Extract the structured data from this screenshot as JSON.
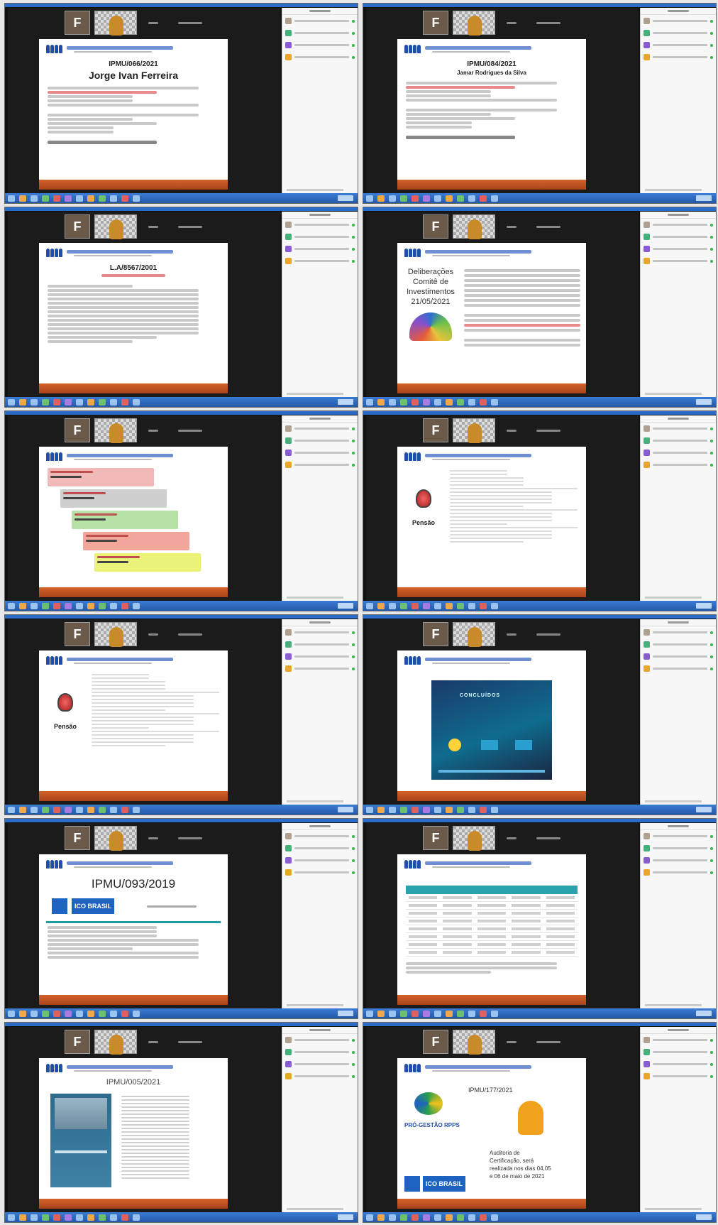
{
  "screenshots": [
    {
      "id": 1,
      "kind": "person",
      "ref": "IPMU/066/2021",
      "person": "Jorge Ivan Ferreira"
    },
    {
      "id": 2,
      "kind": "person-small",
      "ref": "IPMU/084/2021",
      "person": "Jamar Rodrigues da Silva"
    },
    {
      "id": 3,
      "kind": "redref",
      "ref": "L.A/8567/2001",
      "person": ""
    },
    {
      "id": 4,
      "kind": "delib",
      "title_lines": [
        "Deliberações",
        "Comitê de",
        "Investimentos",
        "21/05/2021"
      ]
    },
    {
      "id": 5,
      "kind": "stair"
    },
    {
      "id": 6,
      "kind": "pensao",
      "label": "Pensão"
    },
    {
      "id": 7,
      "kind": "pensao",
      "label": "Pensão"
    },
    {
      "id": 8,
      "kind": "webinar",
      "banner": "CONCLUÍDOS"
    },
    {
      "id": 9,
      "kind": "ico",
      "ref": "IPMU/093/2019",
      "ico_text": "ICO BRASIL"
    },
    {
      "id": 10,
      "kind": "table"
    },
    {
      "id": 11,
      "kind": "book",
      "ref": "IPMU/005/2021"
    },
    {
      "id": 12,
      "kind": "progestao",
      "ref": "IPMU/177/2021",
      "program": "PRÓ-GESTÃO RPPS",
      "ico_text": "ICO BRASIL",
      "audit_lines": [
        "Auditoria de",
        "Certificação, será",
        "realizada nos dias 04,05",
        "e 06 de maio de 2021"
      ]
    }
  ],
  "video": {
    "tile_letter": "F"
  },
  "colors": {
    "taskbar": "#2a6cc8",
    "slide_footer": "#c0501f",
    "brand": "#1f4fa8",
    "accent_red": "#d32020",
    "teal": "#2aa3ac"
  }
}
